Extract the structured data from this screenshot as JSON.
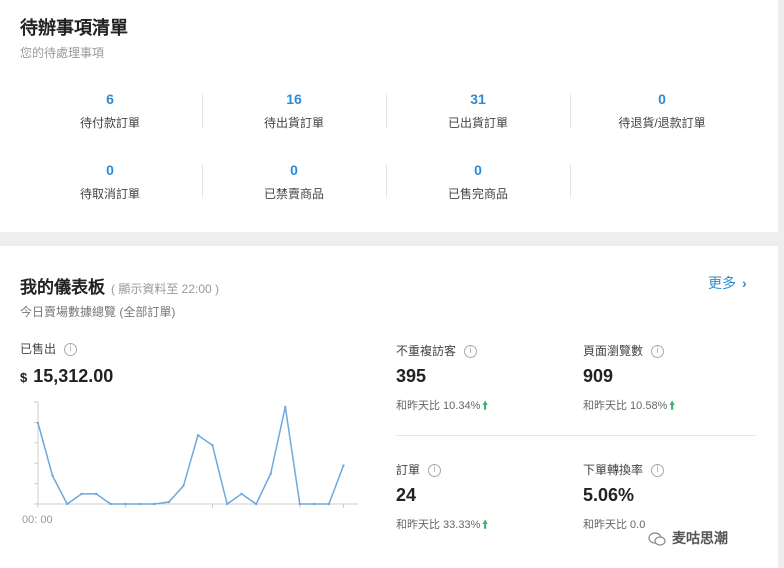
{
  "todo": {
    "title": "待辦事項清單",
    "subtitle": "您的待處理事項",
    "items": [
      {
        "value": "6",
        "label": "待付款訂單"
      },
      {
        "value": "16",
        "label": "待出貨訂單"
      },
      {
        "value": "31",
        "label": "已出貨訂單"
      },
      {
        "value": "0",
        "label": "待退貨/退款訂單"
      },
      {
        "value": "0",
        "label": "待取消訂單"
      },
      {
        "value": "0",
        "label": "已禁賣商品"
      },
      {
        "value": "0",
        "label": "已售完商品"
      }
    ]
  },
  "dashboard": {
    "title": "我的儀表板",
    "note": "( 顯示資料至 22:00 )",
    "subtitle": "今日賣場數據總覽 (全部訂單)",
    "more_label": "更多",
    "sales": {
      "label": "已售出",
      "currency": "$",
      "value": "15,312.00",
      "axis_start_label": "00: 00"
    },
    "metrics": [
      {
        "label": "不重複訪客",
        "value": "395",
        "compare": "和昨天比 10.34%"
      },
      {
        "label": "頁面瀏覽數",
        "value": "909",
        "compare": "和昨天比 10.58%"
      },
      {
        "label": "訂單",
        "value": "24",
        "compare": "和昨天比 33.33%"
      },
      {
        "label": "下單轉換率",
        "value": "5.06%",
        "compare": "和昨天比 0.0"
      }
    ]
  },
  "watermark": {
    "text": "麦咕思潮"
  },
  "chart_data": {
    "type": "line",
    "x": [
      "00:00",
      "01:00",
      "02:00",
      "03:00",
      "04:00",
      "05:00",
      "06:00",
      "07:00",
      "08:00",
      "09:00",
      "10:00",
      "11:00",
      "12:00",
      "13:00",
      "14:00",
      "15:00",
      "16:00",
      "17:00",
      "18:00",
      "19:00",
      "20:00",
      "21:00",
      "22:00"
    ],
    "values": [
      80,
      28,
      0,
      10,
      10,
      0,
      0,
      0,
      0,
      2,
      18,
      68,
      58,
      0,
      10,
      0,
      30,
      96,
      0,
      0,
      0,
      38
    ],
    "color": "#6fa8dc",
    "grid": false
  }
}
